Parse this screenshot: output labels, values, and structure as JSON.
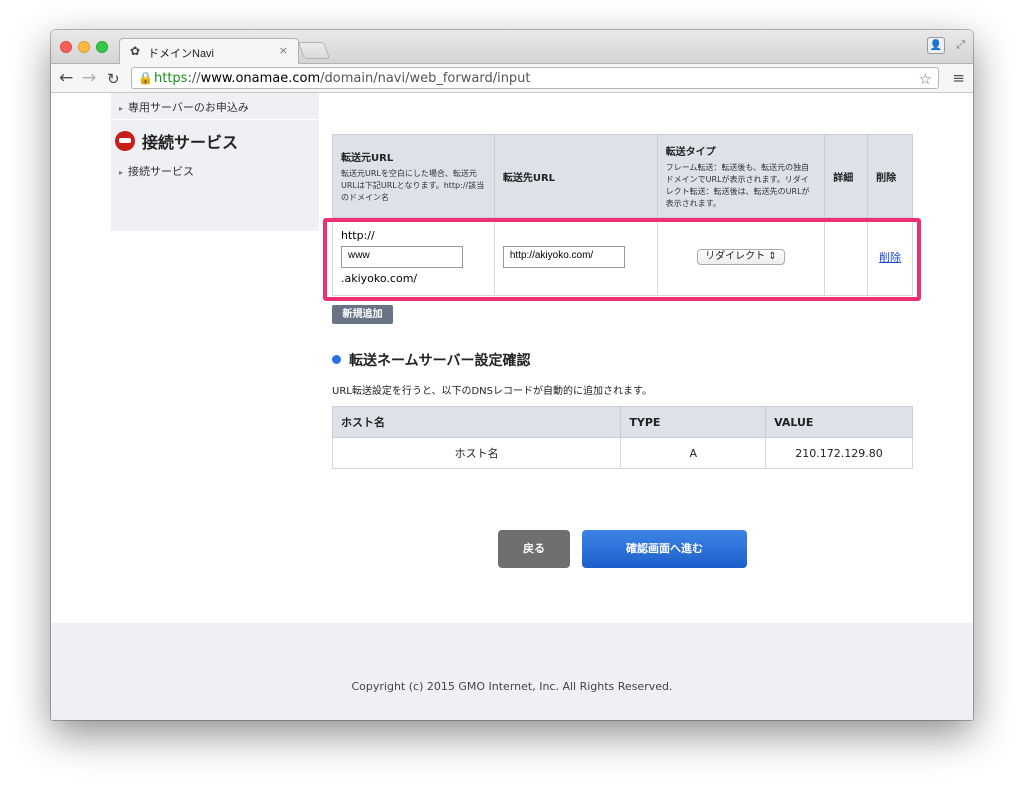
{
  "browser": {
    "tab_title": "ドメインNavi",
    "tab_close": "×",
    "url_scheme": "https",
    "url_sep": "://",
    "url_host": "www.onamae.com",
    "url_path": "/domain/navi/web_forward/input"
  },
  "sidebar": {
    "item_top": "専用サーバーのお申込み",
    "heading": "接続サービス",
    "item_sub": "接続サービス"
  },
  "forward_table": {
    "headers": {
      "source": "転送元URL",
      "source_note": "転送元URLを空白にした場合、転送元URLは下記URLとなります。http://該当のドメイン名",
      "dest": "転送先URL",
      "type": "転送タイプ",
      "type_note": "フレーム転送：転送後も、転送元の独自ドメインでURLが表示されます。リダイレクト転送：転送後は、転送先のURLが表示されます。",
      "detail": "詳細",
      "delete": "削除"
    },
    "row": {
      "prefix": "http://",
      "subdomain_value": "www",
      "suffix": ".akiyoko.com/",
      "dest_value": "http://akiyoko.com/",
      "type_selected": "リダイレクト",
      "delete_link": "削除"
    }
  },
  "add_button": "新規追加",
  "dns_section": {
    "title": "転送ネームサーバー設定確認",
    "description": "URL転送設定を行うと、以下のDNSレコードが自動的に追加されます。",
    "headers": [
      "ホスト名",
      "TYPE",
      "VALUE"
    ],
    "row": [
      "ホスト名",
      "A",
      "210.172.129.80"
    ]
  },
  "buttons": {
    "back": "戻る",
    "next": "確認画面へ進む"
  },
  "footer": {
    "copyright": "Copyright (c) 2015 GMO Internet, Inc. All Rights Reserved."
  },
  "colors": {
    "highlight": "#ed2f73",
    "primary_button": "#2b6fe0",
    "table_header": "#dde1e8"
  }
}
